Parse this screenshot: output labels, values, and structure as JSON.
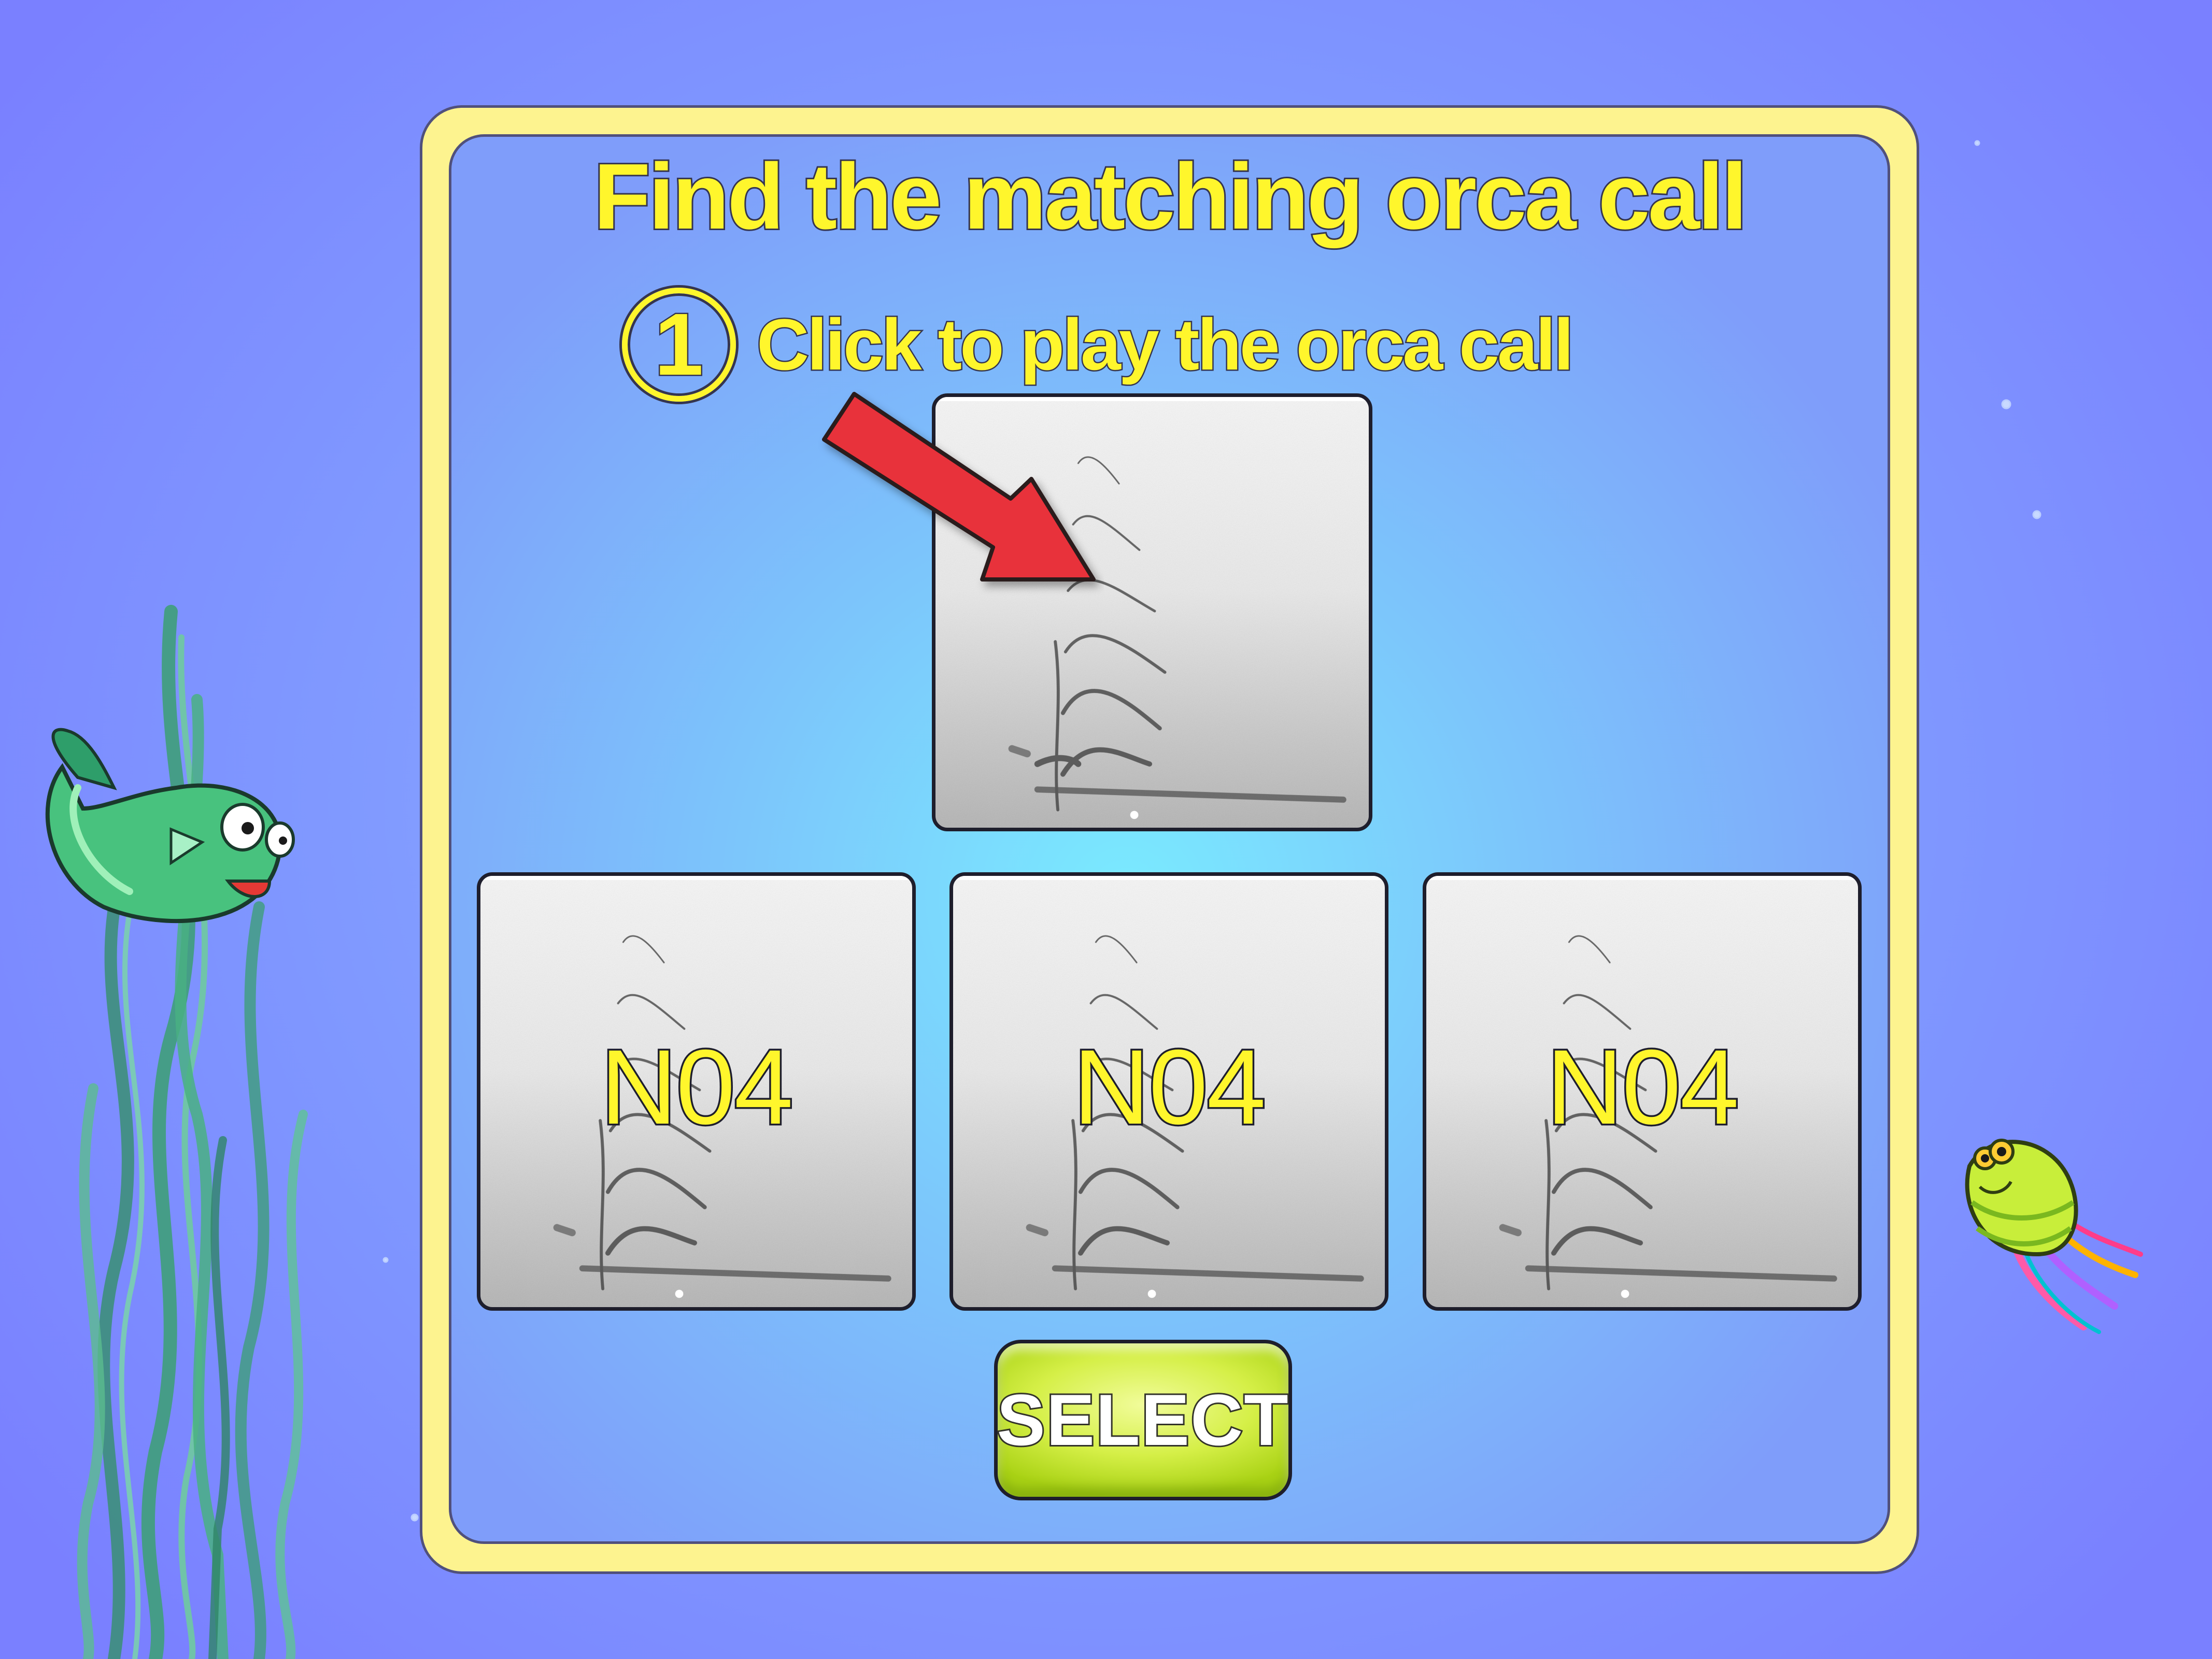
{
  "game": {
    "title": "Find the matching orca call",
    "step": {
      "number": "1",
      "instruction": "Click to play the orca call"
    },
    "target_call": {
      "icon": "spectrogram"
    },
    "choices": [
      {
        "label": "N04",
        "icon": "spectrogram"
      },
      {
        "label": "N04",
        "icon": "spectrogram"
      },
      {
        "label": "N04",
        "icon": "spectrogram"
      }
    ],
    "select_button": {
      "label": "SELECT"
    }
  },
  "decorations": {
    "left": [
      "seaweed-icon",
      "fish-icon"
    ],
    "right": [
      "jellyfish-icon",
      "bubble-icon"
    ],
    "pointer": "arrow-icon"
  },
  "colors": {
    "background": "#7f97ff",
    "panel_frame": "#fdf38f",
    "panel_inner_center": "#7aeaff",
    "title_text": "#fff62c",
    "arrow": "#e8303a",
    "select_button": "#d5ef47"
  }
}
